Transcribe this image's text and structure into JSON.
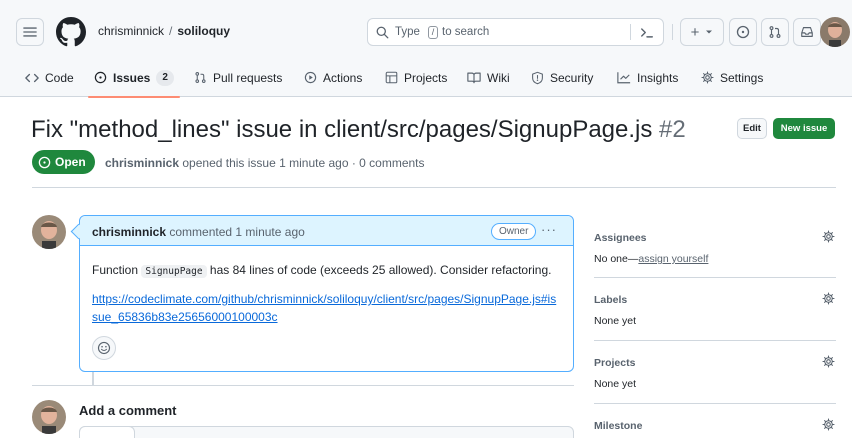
{
  "header": {
    "repo_owner": "chrisminnick",
    "repo_sep": "/",
    "repo_name": "soliloquy",
    "search_prefix": "Type",
    "search_key": "/",
    "search_suffix": "to search",
    "plus_label": "+"
  },
  "tabs": [
    {
      "label": "Code",
      "icon": "code-icon"
    },
    {
      "label": "Issues",
      "icon": "issue-opened-icon",
      "count": "2",
      "selected": true
    },
    {
      "label": "Pull requests",
      "icon": "git-pull-request-icon"
    },
    {
      "label": "Actions",
      "icon": "play-icon"
    },
    {
      "label": "Projects",
      "icon": "table-icon"
    },
    {
      "label": "Wiki",
      "icon": "book-icon"
    },
    {
      "label": "Security",
      "icon": "shield-icon"
    },
    {
      "label": "Insights",
      "icon": "graph-icon"
    },
    {
      "label": "Settings",
      "icon": "gear-icon"
    }
  ],
  "issue": {
    "title": "Fix \"method_lines\" issue in client/src/pages/SignupPage.js",
    "number": "#2",
    "edit_label": "Edit",
    "new_issue_label": "New issue",
    "state": "Open",
    "author": "chrisminnick",
    "meta_text": "opened this issue 1 minute ago · 0 comments"
  },
  "comment": {
    "author": "chrisminnick",
    "action": "commented 1 minute ago",
    "role_badge": "Owner",
    "menu_label": "···",
    "body_prefix": "Function",
    "body_code": "SignupPage",
    "body_suffix": "has 84 lines of code (exceeds 25 allowed). Consider refactoring.",
    "link": "https://codeclimate.com/github/chrisminnick/soliloquy/client/src/pages/SignupPage.js#issue_65836b83e25656000100003c"
  },
  "new_comment": {
    "heading": "Add a comment"
  },
  "sidebar": {
    "assignees": {
      "title": "Assignees",
      "value_prefix": "No one—",
      "value_link": "assign yourself"
    },
    "labels": {
      "title": "Labels",
      "value": "None yet"
    },
    "projects": {
      "title": "Projects",
      "value": "None yet"
    },
    "milestone": {
      "title": "Milestone"
    }
  },
  "colors": {
    "accent_green": "#1f883d",
    "link_blue": "#0969da",
    "tab_underline": "#fd8c73",
    "comment_header_bg": "#ddf4ff"
  }
}
